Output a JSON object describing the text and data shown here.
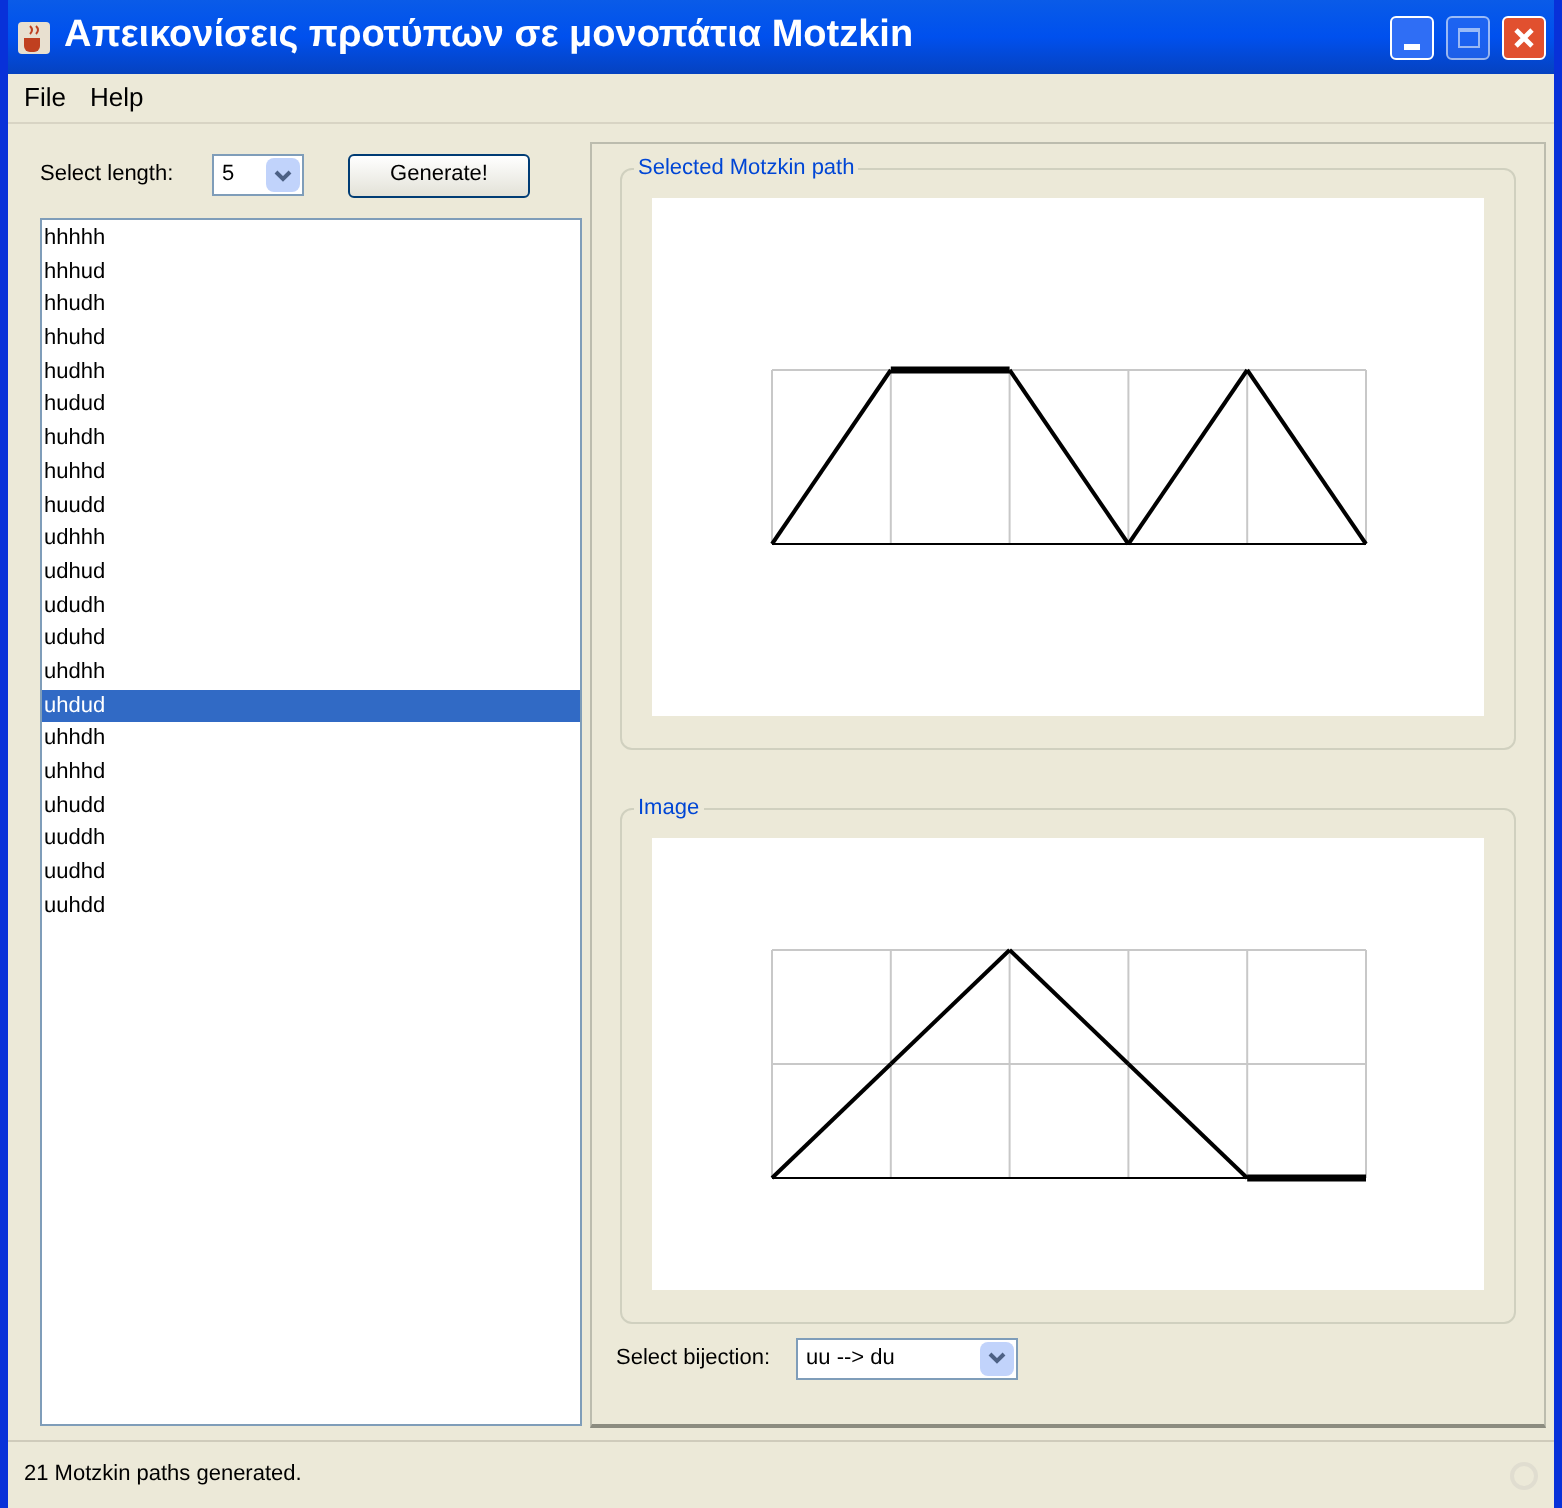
{
  "window": {
    "title": "Απεικονίσεις προτύπων σε μονοπάτια Motzkin"
  },
  "menu": [
    "File",
    "Help"
  ],
  "length": {
    "label": "Select length:",
    "value": "5"
  },
  "generate_button": "Generate!",
  "paths": [
    {
      "label": "hhhhh",
      "selected": false
    },
    {
      "label": "hhhud",
      "selected": false
    },
    {
      "label": "hhudh",
      "selected": false
    },
    {
      "label": "hhuhd",
      "selected": false
    },
    {
      "label": "hudhh",
      "selected": false
    },
    {
      "label": "hudud",
      "selected": false
    },
    {
      "label": "huhdh",
      "selected": false
    },
    {
      "label": "huhhd",
      "selected": false
    },
    {
      "label": "huudd",
      "selected": false
    },
    {
      "label": "udhhh",
      "selected": false
    },
    {
      "label": "udhud",
      "selected": false
    },
    {
      "label": "ududh",
      "selected": false
    },
    {
      "label": "uduhd",
      "selected": false
    },
    {
      "label": "uhdhh",
      "selected": false
    },
    {
      "label": "uhdud",
      "selected": true
    },
    {
      "label": "uhhdh",
      "selected": false
    },
    {
      "label": "uhhhd",
      "selected": false
    },
    {
      "label": "uhudd",
      "selected": false
    },
    {
      "label": "uuddh",
      "selected": false
    },
    {
      "label": "uudhd",
      "selected": false
    },
    {
      "label": "uuhdd",
      "selected": false
    }
  ],
  "selected_group": {
    "title": "Selected Motzkin path"
  },
  "image_group": {
    "title": "Image"
  },
  "bijection": {
    "label": "Select bijection:",
    "value": "uu --> du"
  },
  "status_bar": "21 Motzkin paths generated."
}
